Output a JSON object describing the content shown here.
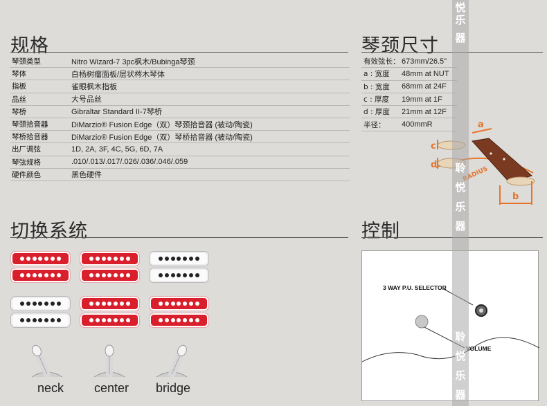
{
  "sections": {
    "specs_title": "规格",
    "neck_dims_title": "琴颈尺寸",
    "switching_title": "切换系统",
    "controls_title": "控制"
  },
  "specs": [
    {
      "key": "琴颈类型",
      "value": "Nitro Wizard-7 3pc枫木/Bubinga琴颈"
    },
    {
      "key": "琴体",
      "value": "白杨树瘤面板/层状梣木琴体"
    },
    {
      "key": "指板",
      "value": "雀眼枫木指板"
    },
    {
      "key": "品丝",
      "value": "大号品丝"
    },
    {
      "key": "琴桥",
      "value": "Gibraltar Standard II-7琴桥"
    },
    {
      "key": "琴颈拾音器",
      "value": "DiMarzio® Fusion Edge（双）琴颈拾音器 (被动/陶瓷)"
    },
    {
      "key": "琴桥拾音器",
      "value": "DiMarzio® Fusion Edge（双）琴桥拾音器 (被动/陶瓷)"
    },
    {
      "key": "出厂调弦",
      "value": "1D, 2A, 3F, 4C, 5G, 6D, 7A"
    },
    {
      "key": "琴弦规格",
      "value": ".010/.013/.017/.026/.036/.046/.059"
    },
    {
      "key": "硬件颜色",
      "value": "黑色硬件"
    }
  ],
  "neck_dims": [
    {
      "key": "有效弦长：",
      "value": "673mm/26.5\""
    },
    {
      "key": "a : 宽度",
      "value": "48mm at NUT"
    },
    {
      "key": "b : 宽度",
      "value": "68mm at 24F"
    },
    {
      "key": "c : 厚度",
      "value": "19mm at 1F"
    },
    {
      "key": "d : 厚度",
      "value": "21mm at 12F"
    },
    {
      "key": "半径：",
      "value": "400mmR"
    }
  ],
  "neck_diagram": {
    "label_a": "a",
    "label_b": "b",
    "label_c": "c",
    "label_d": "d",
    "label_radius": "RADIUS"
  },
  "pickup_configs": [
    {
      "top": "red",
      "bottom": "red"
    },
    {
      "top": "red",
      "bottom": "red"
    },
    {
      "top": "white",
      "bottom": "white"
    },
    {
      "top": "white",
      "bottom": "white"
    },
    {
      "top": "red",
      "bottom": "red"
    },
    {
      "top": "red",
      "bottom": "red"
    }
  ],
  "switch_positions": [
    "neck",
    "center",
    "bridge"
  ],
  "controls": {
    "selector_label": "3 WAY P.U. SELECTOR",
    "volume_label": "VOLUME"
  },
  "watermark": [
    "聆",
    "悦",
    "乐",
    "器"
  ],
  "colors": {
    "pickup_red": "#d91f2b",
    "pickup_white": "#fbfbfb",
    "background": "#dddcd9",
    "neck_wood": "#7a3a22",
    "dimension_orange": "#e8742a"
  }
}
